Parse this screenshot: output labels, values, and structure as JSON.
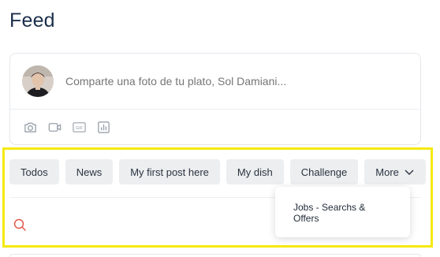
{
  "page": {
    "title": "Feed"
  },
  "composer": {
    "placeholder": "Comparte una foto de tu plato, Sol Damiani...",
    "tools": [
      {
        "name": "camera-icon"
      },
      {
        "name": "video-icon"
      },
      {
        "name": "gif-icon",
        "label": "GIF"
      },
      {
        "name": "poll-icon"
      }
    ]
  },
  "tabs": [
    {
      "label": "Todos"
    },
    {
      "label": "News"
    },
    {
      "label": "My first post here"
    },
    {
      "label": "My dish"
    },
    {
      "label": "Challenge"
    },
    {
      "label": "More"
    }
  ],
  "dropdown": {
    "items": [
      {
        "label": "Jobs - Searchs & Offers"
      }
    ]
  },
  "colors": {
    "highlight": "#f5e90d",
    "search_icon": "#e4574c",
    "tab_bg": "#eceeef"
  }
}
